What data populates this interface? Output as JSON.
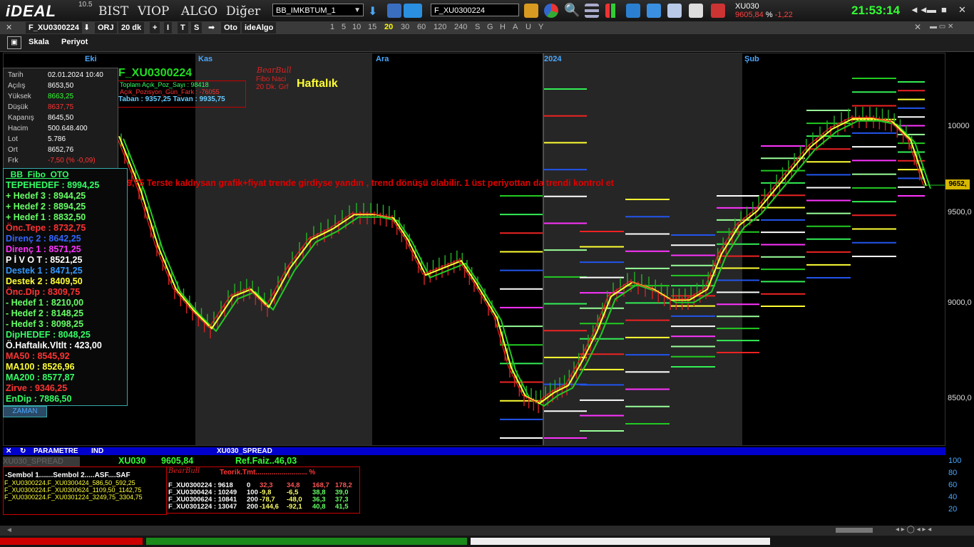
{
  "app": {
    "logo": "iDEAL",
    "version": "10.5",
    "menu": [
      "BIST",
      "VIOP",
      "ALGO",
      "Diğer"
    ]
  },
  "toolbar": {
    "dropdown_value": "BB_IMKBTUM_1",
    "symbol_input": "F_XU0300224"
  },
  "quote": {
    "symbol": "XU030",
    "price": "9605,84",
    "pct": "%",
    "change": "-1,22"
  },
  "clock": "21:53:14",
  "window_buttons": [
    "◄◄",
    "▬",
    "■",
    "✕"
  ],
  "bar2": {
    "symbol": "F_XU0300224",
    "items": [
      "ORJ",
      "20 dk",
      "+",
      "I",
      "T",
      "S",
      "Oto",
      "ideAlgo"
    ],
    "periods": [
      "1",
      "5",
      "10",
      "15",
      "20",
      "30",
      "60",
      "120",
      "240",
      "S",
      "G",
      "H",
      "A",
      "U",
      "Y"
    ],
    "active_period": "20"
  },
  "bar3": {
    "scale": "Skala",
    "period": "Periyot"
  },
  "months": [
    "Eki",
    "Kas",
    "Ara",
    "2024",
    "Şub"
  ],
  "y_axis": [
    "10000",
    "9500,0",
    "9000,0",
    "8500,0"
  ],
  "price_tag": "9652,",
  "info": [
    {
      "k": "Tarih",
      "v": "02.01.2024 10:40",
      "c": "#ffffff"
    },
    {
      "k": "Açılış",
      "v": "8653,50",
      "c": "#ffffff"
    },
    {
      "k": "Yüksek",
      "v": "8663,25",
      "c": "#33ff33"
    },
    {
      "k": "Düşük",
      "v": "8637,75",
      "c": "#ff3333"
    },
    {
      "k": "Kapanış",
      "v": "8645,50",
      "c": "#ffffff"
    },
    {
      "k": "Hacim",
      "v": "500.648.400",
      "c": "#ffffff"
    },
    {
      "k": "Lot",
      "v": "5.786",
      "c": "#ffffff"
    },
    {
      "k": "Ort",
      "v": "8652,76",
      "c": "#ffffff"
    },
    {
      "k": "Frk",
      "v": "-7,50 (% -0,09)",
      "c": "#ff3333"
    }
  ],
  "title_symbol": "F_XU0300224",
  "oi": {
    "line1": "Toplam Açık_Poz_Sayı : 98418",
    "line2": "Açık_Pozisyon_Gün_Fark : -76055",
    "line3": "Taban : 9357,25   Tavan : 9935,75"
  },
  "bearbull": "BearBull",
  "fibo_text": "Fibo Naci",
  "tf_text": "20 Dk. Grf",
  "weekly": "Haftalık",
  "note": "9,75  Terste kaldıysan grafik+fiyat trende girdiyse yandın , trend dönüşü olabilir. 1 üst periyottan da trendi kontrol et",
  "fibo_title": "_BB_Fibo_OTO",
  "fibo_lines": [
    {
      "t": "TEPEHEDEF :  8994,25",
      "c": "#33ff66"
    },
    {
      "t": "+ Hedef 3 :  8944,25",
      "c": "#66ff66"
    },
    {
      "t": "+ Hedef 2 :  8894,25",
      "c": "#66ff66"
    },
    {
      "t": "+ Hedef 1 :  8832,50",
      "c": "#66ff66"
    },
    {
      "t": "Önc.Tepe :  8732,75",
      "c": "#ff3333"
    },
    {
      "t": "Direnç 2  :  8642,25",
      "c": "#3366ff"
    },
    {
      "t": "Direnç 1  :  8571,25",
      "c": "#ff33ff"
    },
    {
      "t": "P İ V O T :  8521,25",
      "c": "#ffffff"
    },
    {
      "t": "Destek 1  :  8471,25",
      "c": "#3399ff"
    },
    {
      "t": "Destek 2  :  8409,50",
      "c": "#ffff33"
    },
    {
      "t": "Önc.Dip  :  8309,75",
      "c": "#ff3333"
    },
    {
      "t": "- Hedef 1 :  8210,00",
      "c": "#66ff66"
    },
    {
      "t": "- Hedef 2 :  8148,25",
      "c": "#66ff66"
    },
    {
      "t": "- Hedef 3 :  8098,25",
      "c": "#66ff66"
    },
    {
      "t": "DipHEDEF :  8048,25",
      "c": "#33ff66"
    },
    {
      "t": "Ö.Haftalık.Vltlt :  423,00",
      "c": "#ffffff"
    },
    {
      "t": "MA50 :  8545,92",
      "c": "#ff3333"
    },
    {
      "t": "MA100 :  8526,96",
      "c": "#ffff33"
    },
    {
      "t": "MA200 :  8577,87",
      "c": "#33ff66"
    },
    {
      "t": "Zirve :  9346,25",
      "c": "#ff3333"
    },
    {
      "t": "EnDip :  7886,50",
      "c": "#33ff66"
    }
  ],
  "fibo_btn": "ZAMAN",
  "param": {
    "close": "✕",
    "refresh": "↻",
    "label": "PARAMETRE",
    "ind": "IND",
    "spread": "XU030_SPREAD"
  },
  "bottom": {
    "spread_btn": "XU030_SPREAD",
    "sym": "XU030",
    "price": "9605,84",
    "ref": "Ref.Faiz..46,03"
  },
  "spread": {
    "header": "-Sembol 1.......Sembol 2.....ASF....SAF",
    "rows": [
      "F_XU0300224.F_XU0300424_586,50_592,25",
      "F_XU0300224.F_XU0300624_1109,50_1142,75",
      "F_XU0300224.F_XU0301224_3249,75_3304,75"
    ]
  },
  "teorik": {
    "title": "Teorik.Tmt..........................   %",
    "rows": [
      {
        "a": "F_XU0300224 : 9618",
        "b": "0",
        "c": "32,3",
        "d": "34,8",
        "e": "168,7",
        "f": "178,2"
      },
      {
        "a": "F_XU0300424 : 10249",
        "b": "100",
        "c": "-9,8",
        "d": "-6,5",
        "e": "38,8",
        "f": "39,0"
      },
      {
        "a": "F_XU0300624 : 10841",
        "b": "200",
        "c": "-78,7",
        "d": "-48,0",
        "e": "36,3",
        "f": "37,3"
      },
      {
        "a": "F_XU0301224 : 13047",
        "b": "200",
        "c": "-144,6",
        "d": "-92,1",
        "e": "40,8",
        "f": "41,5"
      }
    ]
  },
  "bottom_axis": [
    "100",
    "80",
    "60",
    "40",
    "20"
  ]
}
